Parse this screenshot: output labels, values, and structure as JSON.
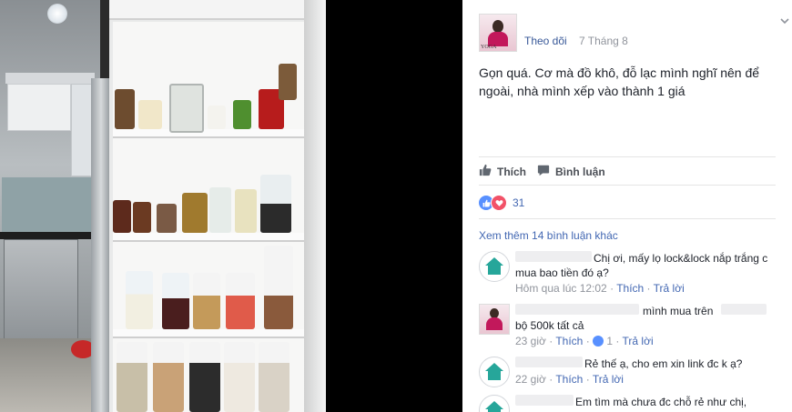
{
  "post": {
    "follow_label": "Theo dõi",
    "date": "7 Tháng 8",
    "text": "Gọn quá. Cơ mà đồ khô, đỗ lạc mình nghĩ nên để ngoài, nhà mình xếp vào thành 1 giá"
  },
  "actions": {
    "like_label": "Thích",
    "comment_label": "Bình luận"
  },
  "reactions": {
    "count": "31"
  },
  "more_comments_label": "Xem thêm 14 bình luận khác",
  "comments": [
    {
      "line1": "Chị ơi, mấy lọ lock&lock nắp trắng c",
      "line2": "mua bao tiền đó ạ?",
      "time": "Hôm qua lúc 12:02",
      "like": "Thích",
      "reply": "Trả lời"
    },
    {
      "line1": "mình mua trên",
      "line2": "bộ 500k tất cả",
      "time": "23 giờ",
      "like": "Thích",
      "likes_count": "1",
      "reply": "Trả lời"
    },
    {
      "line1": "Rẻ thế ạ, cho em xin link đc k ạ?",
      "time": "22 giờ",
      "like": "Thích",
      "reply": "Trả lời"
    },
    {
      "line1": "Em tìm mà chưa đc chỗ rẻ như chị,"
    }
  ],
  "colors": {
    "link": "#385898",
    "meta": "#90949c",
    "like_blue": "#5890ff",
    "love_red": "#f25268"
  },
  "icons": {
    "like": "thumbs-up-icon",
    "comment": "speech-bubble-icon",
    "menu": "chevron-down-icon"
  }
}
